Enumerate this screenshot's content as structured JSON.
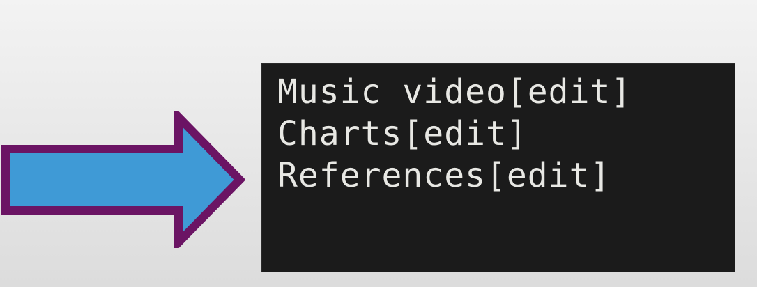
{
  "arrow": {
    "icon": "right-arrow-icon",
    "fill_color": "#3f9ad6",
    "outline_color": "#6b1464"
  },
  "console": {
    "background_color": "#1b1b1b",
    "text_color": "#e8e8e4",
    "lines": [
      "Music video[edit]",
      "Charts[edit]",
      "References[edit]"
    ]
  }
}
